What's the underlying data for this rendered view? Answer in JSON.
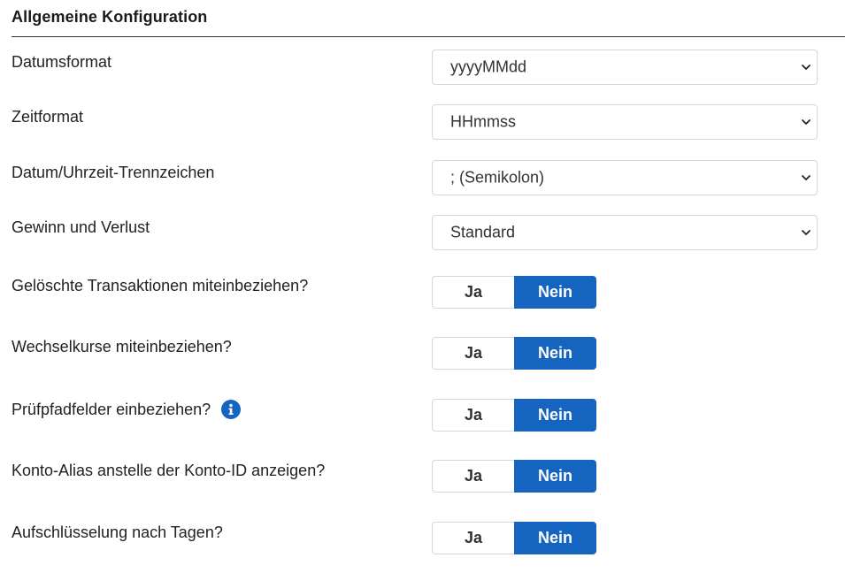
{
  "section": {
    "title": "Allgemeine Konfiguration"
  },
  "selects": [
    {
      "label": "Datumsformat",
      "value": "yyyyMMdd"
    },
    {
      "label": "Zeitformat",
      "value": "HHmmss"
    },
    {
      "label": "Datum/Uhrzeit-Trennzeichen",
      "value": "; (Semikolon)"
    },
    {
      "label": "Gewinn und Verlust",
      "value": "Standard"
    }
  ],
  "toggles": [
    {
      "label": "Gelöschte Transaktionen miteinbeziehen?",
      "yes": "Ja",
      "no": "Nein",
      "selected": "Nein"
    },
    {
      "label": "Wechselkurse miteinbeziehen?",
      "yes": "Ja",
      "no": "Nein",
      "selected": "Nein"
    },
    {
      "label": "Prüfpfadfelder einbeziehen?",
      "yes": "Ja",
      "no": "Nein",
      "selected": "Nein",
      "icon": "info-icon"
    },
    {
      "label": "Konto-Alias anstelle der Konto-ID anzeigen?",
      "yes": "Ja",
      "no": "Nein",
      "selected": "Nein"
    },
    {
      "label": "Aufschlüsselung nach Tagen?",
      "yes": "Ja",
      "no": "Nein",
      "selected": "Nein"
    }
  ],
  "colors": {
    "accent": "#1565c0",
    "border": "#d6d6d6",
    "text": "#222222"
  }
}
